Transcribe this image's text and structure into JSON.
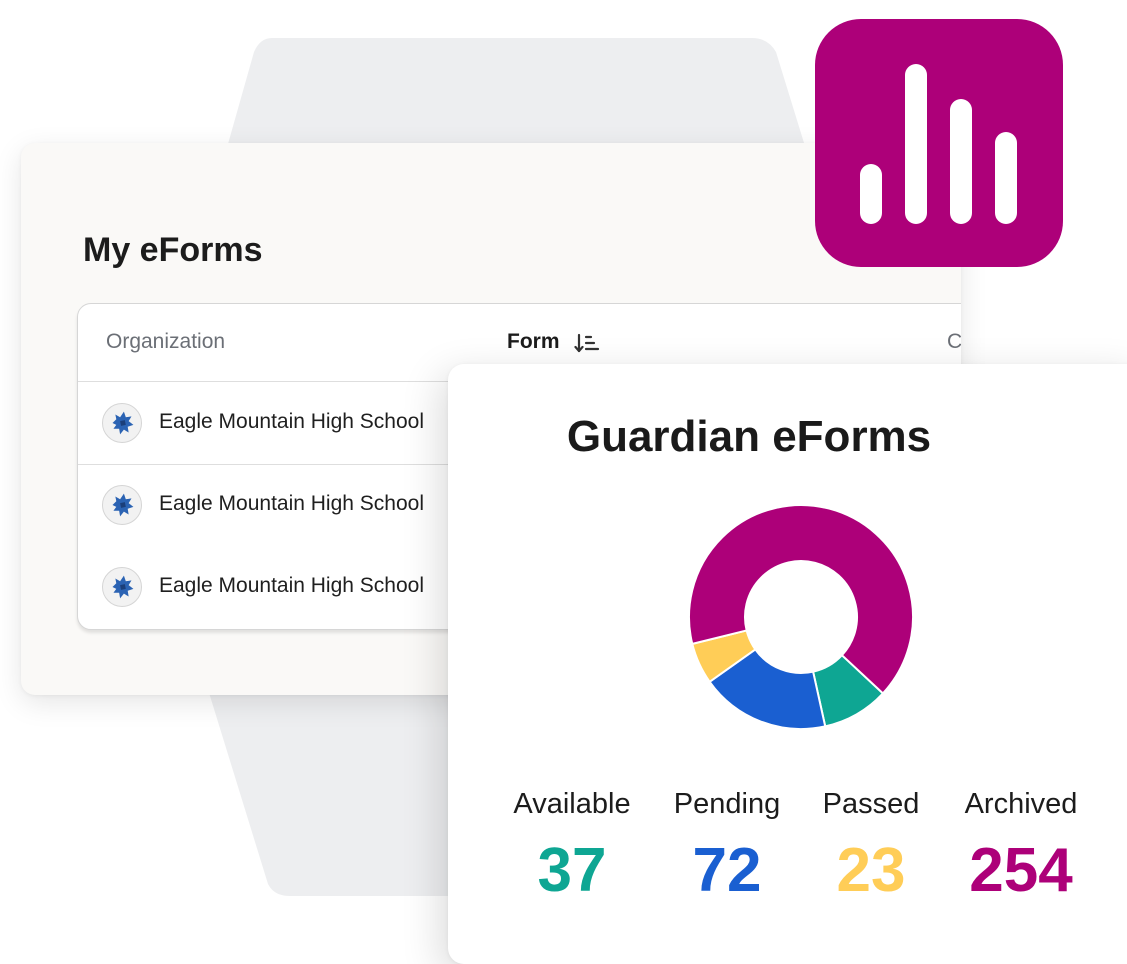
{
  "my_eforms": {
    "title": "My eForms",
    "table": {
      "columns": [
        {
          "label": "Organization"
        },
        {
          "label": "Form",
          "sort_icon": "sort-descending-icon"
        },
        {
          "label": "C"
        }
      ],
      "rows": [
        {
          "organization": "Eagle Mountain High School",
          "logo": "school-eagle-logo-icon"
        },
        {
          "organization": "Eagle Mountain High School",
          "logo": "school-eagle-logo-icon"
        },
        {
          "organization": "Eagle Mountain High School",
          "logo": "school-eagle-logo-icon"
        }
      ]
    }
  },
  "app_icon": {
    "name": "bar-chart-app-icon",
    "color": "#ad0079"
  },
  "guardian": {
    "title": "Guardian eForms",
    "stats": [
      {
        "label": "Available",
        "value": "37",
        "color": "#0ea693"
      },
      {
        "label": "Pending",
        "value": "72",
        "color": "#1a5fd1"
      },
      {
        "label": "Passed",
        "value": "23",
        "color": "#ffcd57"
      },
      {
        "label": "Archived",
        "value": "254",
        "color": "#ad0079"
      }
    ]
  },
  "chart_data": {
    "type": "pie",
    "variant": "donut",
    "categories": [
      "Available",
      "Pending",
      "Passed",
      "Archived"
    ],
    "values": [
      37,
      72,
      23,
      254
    ],
    "colors": [
      "#0ea693",
      "#1a5fd1",
      "#ffcd57",
      "#ad0079"
    ]
  }
}
